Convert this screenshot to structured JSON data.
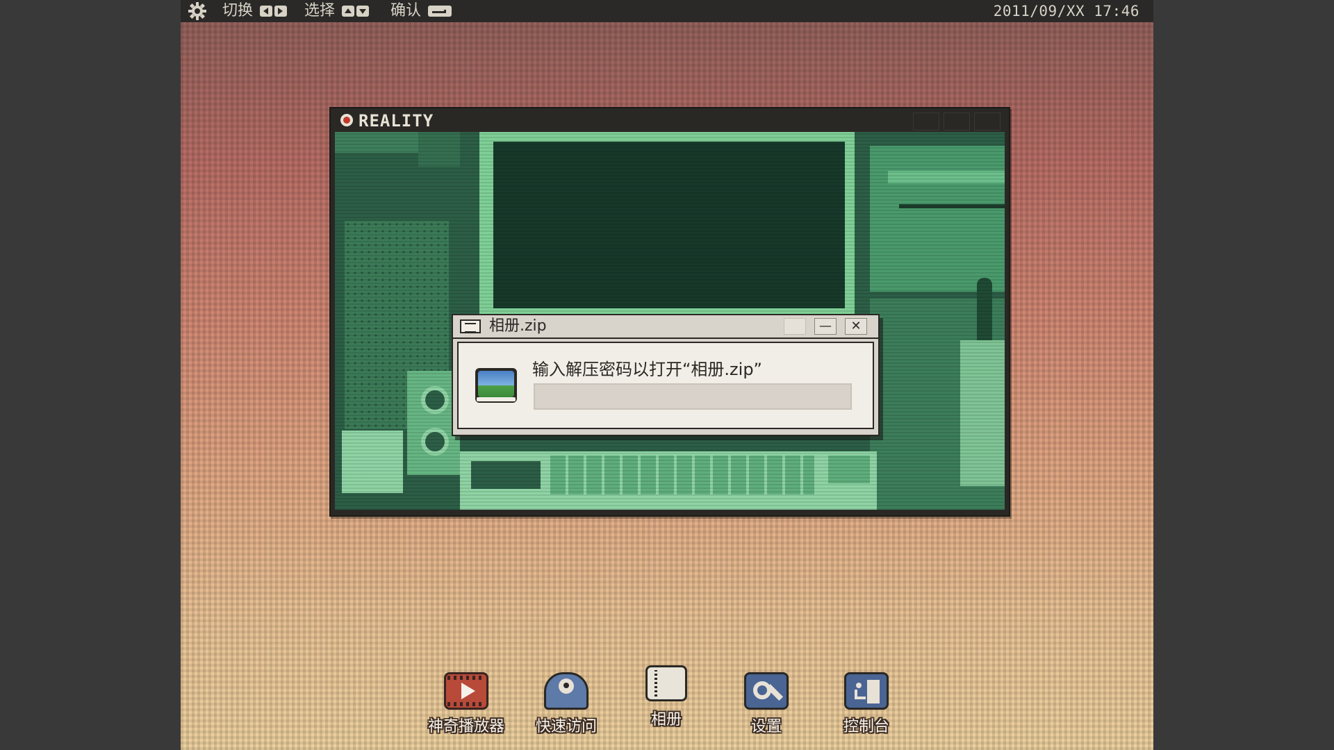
{
  "topbar": {
    "switch_label": "切换",
    "select_label": "选择",
    "confirm_label": "确认",
    "datetime": "2011/09/XX  17:46"
  },
  "reality_window": {
    "title": "REALITY"
  },
  "dialog": {
    "title": "相册.zip",
    "message": "输入解压密码以打开“相册.zip”",
    "password_value": "",
    "minimize_label": "—",
    "close_label": "✕"
  },
  "dock": {
    "items": [
      {
        "label": "神奇播放器",
        "icon": "film-play-icon",
        "color": "#b84a3a"
      },
      {
        "label": "快速访问",
        "icon": "disk-drive-icon",
        "color": "#5d7aa8"
      },
      {
        "label": "相册",
        "icon": "notebook-icon",
        "color": "#e8e4da"
      },
      {
        "label": "设置",
        "icon": "wrench-gear-icon",
        "color": "#4a6594"
      },
      {
        "label": "控制台",
        "icon": "exit-running-man-icon",
        "color": "#4a6594"
      }
    ]
  },
  "colors": {
    "topbar_bg": "#2a2928",
    "scene_green": "#2f6a4f",
    "desktop_top": "#8e5f5a",
    "desktop_bottom": "#ecd09e"
  }
}
